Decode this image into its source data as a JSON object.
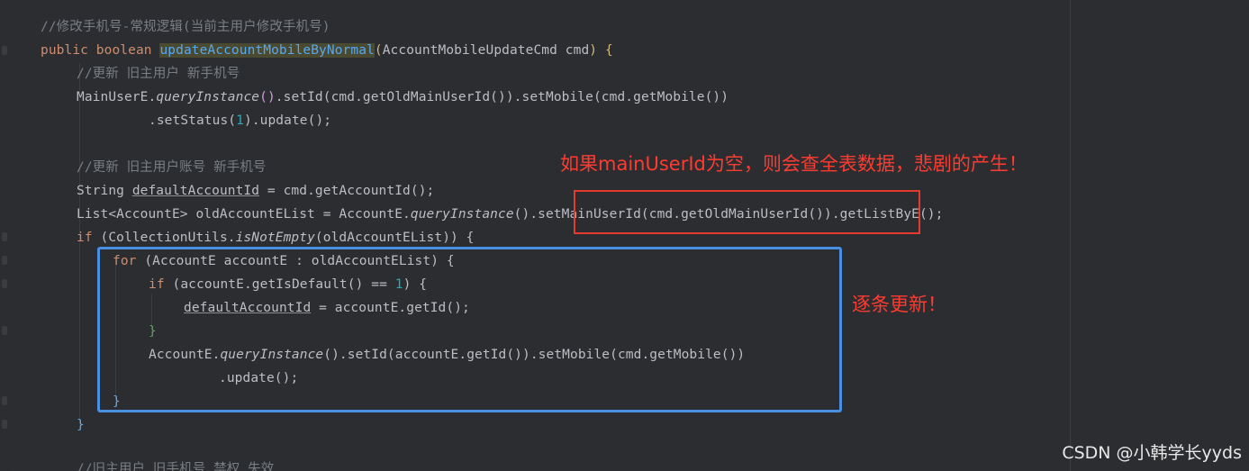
{
  "code": {
    "comment_method": "//修改手机号-常规逻辑(当前主用户修改手机号)",
    "sig_kw": "public boolean ",
    "sig_name": "updateAccountMobileByNormal",
    "sig_params": "AccountMobileUpdateCmd cmd",
    "sig_open": "{",
    "comment_update1": "//更新 旧主用户 新手机号",
    "mainuser_class": "MainUserE.",
    "mainuser_method": "queryInstance",
    "mainuser_rest": ".setId(cmd.getOldMainUserId()).setMobile(cmd.getMobile())",
    "set_status_a": ".setStatus(",
    "set_status_num": "1",
    "set_status_b": ").update();",
    "comment_update2": "//更新 旧主用户账号 新手机号",
    "string_decl_a": "String ",
    "string_decl_var": "defaultAccountId",
    "string_decl_b": " = cmd.getAccountId();",
    "list_decl_a": "List<AccountE> oldAccountEList = AccountE.",
    "list_decl_method": "queryInstance",
    "list_decl_b": "().setMainUserId(cmd.getOldMainUserId()).getListByE();",
    "if_kw": "if ",
    "if_a": "(CollectionUtils.",
    "if_method": "isNotEmpty",
    "if_b": "(oldAccountEList)) {",
    "for_kw": "for ",
    "for_rest": "(AccountE accountE : oldAccountEList) {",
    "inner_if_kw": "if ",
    "inner_if_a": "(accountE.getIsDefault() == ",
    "inner_if_num": "1",
    "inner_if_b": ") {",
    "assign_var": "defaultAccountId",
    "assign_rest": " = accountE.getId();",
    "inner_close": "}",
    "acct_a": "AccountE.",
    "acct_method": "queryInstance",
    "acct_b": "().setId(accountE.getId()).setMobile(cmd.getMobile())",
    "acct_update": ".update();",
    "for_close": "}",
    "if_close": "}",
    "comment_last": "//旧主用户 旧手机号 禁权 失效"
  },
  "annotations": {
    "warning": "如果mainUserId为空，则会查全表数据，悲剧的产生！",
    "loop_note": "逐条更新！"
  },
  "watermark": "CSDN @小韩学长yyds",
  "colors": {
    "background": "#2b2d30",
    "keyword": "#cf8e6d",
    "method": "#56a8f5",
    "comment": "#7a7e85",
    "red_box": "#e53a2e",
    "blue_box": "#4a90e2",
    "annotation": "#ff3b30"
  }
}
